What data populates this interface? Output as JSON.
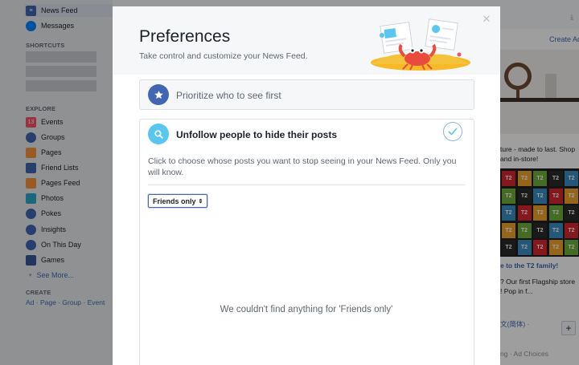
{
  "background": {
    "left_nav": {
      "top_items": [
        {
          "label": "News Feed",
          "icon": "news-feed-icon",
          "color": "#4267b2"
        },
        {
          "label": "Messages",
          "icon": "messages-icon",
          "color": "#0084ff"
        }
      ],
      "shortcuts_heading": "SHORTCUTS",
      "explore_heading": "EXPLORE",
      "explore_items": [
        {
          "label": "Events",
          "icon": "events-icon",
          "color": "#f35369",
          "glyph": "13"
        },
        {
          "label": "Groups",
          "icon": "groups-icon",
          "color": "#4267b2",
          "glyph": ""
        },
        {
          "label": "Pages",
          "icon": "pages-icon",
          "color": "#f7923b",
          "glyph": ""
        },
        {
          "label": "Friend Lists",
          "icon": "friend-lists-icon",
          "color": "#4267b2",
          "glyph": ""
        },
        {
          "label": "Pages Feed",
          "icon": "pages-feed-icon",
          "color": "#f7923b",
          "glyph": ""
        },
        {
          "label": "Photos",
          "icon": "photos-icon",
          "color": "#2ba6cb",
          "glyph": ""
        },
        {
          "label": "Pokes",
          "icon": "pokes-icon",
          "color": "#4267b2",
          "glyph": ""
        },
        {
          "label": "Insights",
          "icon": "insights-icon",
          "color": "#4267b2",
          "glyph": ""
        },
        {
          "label": "On This Day",
          "icon": "on-this-day-icon",
          "color": "#4267b2",
          "glyph": ""
        },
        {
          "label": "Games",
          "icon": "games-icon",
          "color": "#365899",
          "glyph": ""
        }
      ],
      "see_more": "See More...",
      "create_heading": "CREATE",
      "create_links": [
        "Ad",
        "Page",
        "Group",
        "Event"
      ],
      "create_separator": " · "
    },
    "right_column": {
      "create_ad": "Create Ad",
      "ad_text_1": "ture - made to last. Shop",
      "ad_text_2": "and in-store!",
      "ad_title": "e to the T2 family!",
      "ad_body_1": "? Our first Flagship store",
      "ad_body_2": "! Pop in f...",
      "lang_text": "文(简体) ·",
      "footer": "ng · Ad Choices",
      "tile_label": "T2",
      "tile_colors": [
        "#d9262e",
        "#f0a32a",
        "#6fae3a",
        "#2b2b2b",
        "#3a8fc4"
      ]
    }
  },
  "modal": {
    "title": "Preferences",
    "subtitle": "Take control and customize your News Feed.",
    "close_icon": "close-icon",
    "options": [
      {
        "label": "Prioritize who to see first",
        "icon": "star-icon",
        "color": "#4267b2"
      },
      {
        "label": "Unfollow people to hide their posts",
        "icon": "search-icon",
        "color": "#58c6f0"
      }
    ],
    "description": "Click to choose whose posts you want to stop seeing in your News Feed. Only you will know.",
    "filter": {
      "selected": "Friends only",
      "arrow": "⇕"
    },
    "empty_message": "We couldn't find anything for 'Friends only'",
    "accent": "#4267b2"
  }
}
